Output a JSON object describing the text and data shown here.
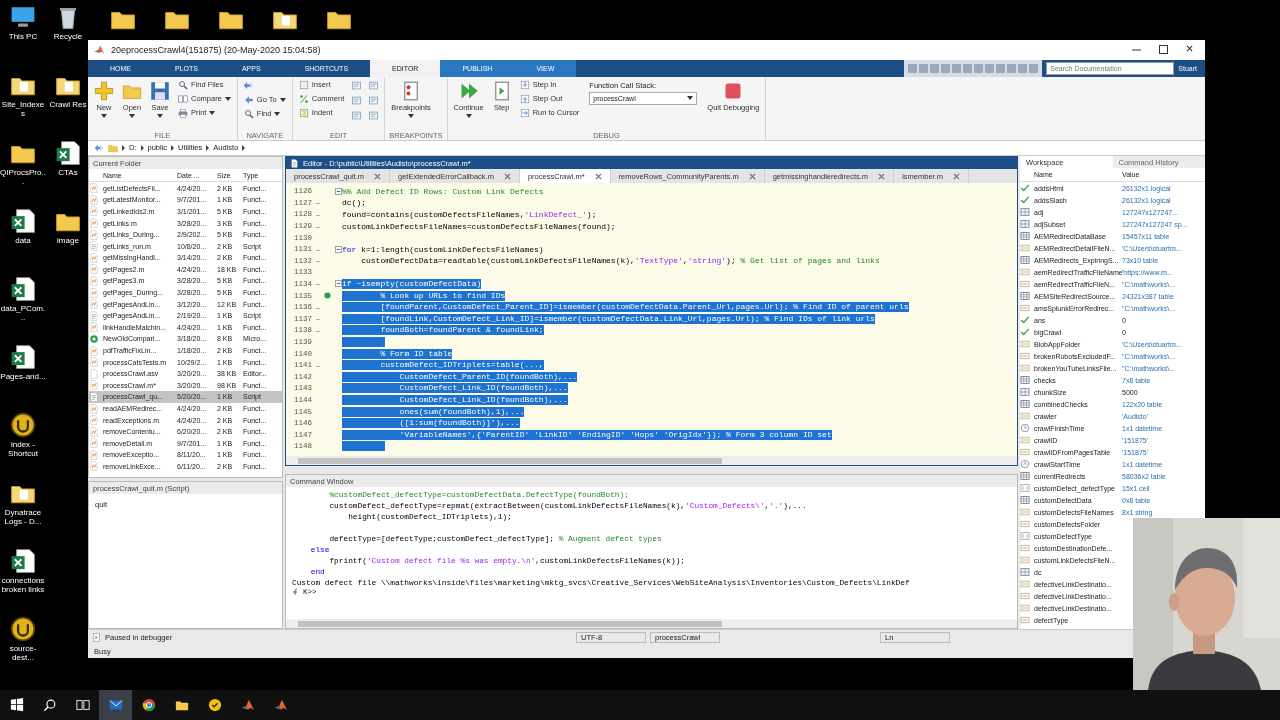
{
  "desktop": {
    "top_icons": [
      {
        "kind": "folder"
      },
      {
        "kind": "folder"
      },
      {
        "kind": "folder"
      },
      {
        "kind": "doc-folder"
      },
      {
        "kind": "folder"
      }
    ],
    "icons": [
      {
        "label": "This PC",
        "kind": "pc"
      },
      {
        "label": "Recycle",
        "kind": "bin"
      },
      {
        "label": "Site_Indexes",
        "kind": "doc-folder"
      },
      {
        "label": "Crawl Res",
        "kind": "doc-folder"
      },
      {
        "label": "QIProcsPro...",
        "kind": "folder"
      },
      {
        "label": "CTAs",
        "kind": "excel"
      },
      {
        "label": "data",
        "kind": "excel"
      },
      {
        "label": "image",
        "kind": "folder"
      },
      {
        "label": "data_PCom...",
        "kind": "excel"
      },
      {
        "label": "Pages-and...",
        "kind": "excel"
      },
      {
        "label": "index - Shortcut",
        "kind": "ue"
      },
      {
        "label": "Dynatrace Logs - D...",
        "kind": "doc-folder"
      },
      {
        "label": "connections broken links",
        "kind": "excel"
      },
      {
        "label": "source-dest...",
        "kind": "ue"
      }
    ]
  },
  "window": {
    "title": "20eprocessCrawl4(151875) (20-May-2020 15:04:58)",
    "tabs": [
      {
        "label": "HOME",
        "selected": false
      },
      {
        "label": "PLOTS",
        "selected": false
      },
      {
        "label": "APPS",
        "selected": false
      },
      {
        "label": "SHORTCUTS",
        "selected": false
      },
      {
        "label": "EDITOR",
        "selected": true
      },
      {
        "label": "PUBLISH",
        "selected": false
      },
      {
        "label": "VIEW",
        "selected": false
      }
    ],
    "search": {
      "placeholder": "Search Documentation"
    },
    "user": "Stuart",
    "toolstrip": [
      {
        "label": "FILE",
        "buttons": [
          {
            "kind": "large",
            "label": "New",
            "dropdown": true
          },
          {
            "kind": "large",
            "label": "Open",
            "dropdown": true
          },
          {
            "kind": "large",
            "label": "Save",
            "dropdown": true
          },
          {
            "kind": "small",
            "label": "Find Files",
            "dropdown": false
          },
          {
            "kind": "small",
            "label": "Compare",
            "dropdown": true
          },
          {
            "kind": "small",
            "label": "Print",
            "dropdown": true
          }
        ]
      },
      {
        "label": "NAVIGATE",
        "buttons": [
          {
            "kind": "icon"
          },
          {
            "kind": "small",
            "label": "Go To",
            "dropdown": true
          },
          {
            "kind": "small",
            "label": "Find",
            "dropdown": true
          }
        ]
      },
      {
        "label": "EDIT",
        "buttons": [
          {
            "kind": "small",
            "label": "Insert",
            "dropdown": false
          },
          {
            "kind": "small",
            "label": "Comment",
            "dropdown": false
          },
          {
            "kind": "small",
            "label": "Indent",
            "dropdown": false
          },
          {
            "kind": "icon"
          },
          {
            "kind": "icon"
          },
          {
            "kind": "icon"
          },
          {
            "kind": "icon"
          },
          {
            "kind": "icon"
          },
          {
            "kind": "icon"
          }
        ]
      },
      {
        "label": "BREAKPOINTS",
        "buttons": [
          {
            "kind": "large",
            "label": "Breakpoints",
            "dropdown": true
          }
        ]
      },
      {
        "label": "DEBUG",
        "buttons": [
          {
            "kind": "large",
            "label": "Continue",
            "dropdown": true
          },
          {
            "kind": "large",
            "label": "Step",
            "dropdown": false
          },
          {
            "kind": "small",
            "label": "Step In",
            "dropdown": false
          },
          {
            "kind": "small",
            "label": "Step Out",
            "dropdown": false
          },
          {
            "kind": "small",
            "label": "Run to Cursor",
            "dropdown": false
          },
          {
            "kind": "select",
            "label": "Function Call Stack:",
            "value": "processCrawl"
          },
          {
            "kind": "large",
            "label": "Quit Debugging",
            "dropdown": false
          }
        ]
      }
    ],
    "address": [
      "D:",
      "public",
      "Utilities",
      "Audisto"
    ]
  },
  "current_folder": {
    "title": "Current Folder",
    "columns": [
      "Name",
      "Date ...",
      "Size",
      "Type"
    ],
    "files": [
      {
        "name": "getListDefectsFil...",
        "date": "4/24/20...",
        "size": "2 KB",
        "type": "Funct...",
        "kind": "function",
        "selected": false
      },
      {
        "name": "getLatestMonitor...",
        "date": "9/7/201...",
        "size": "1 KB",
        "type": "Funct...",
        "kind": "function",
        "selected": false
      },
      {
        "name": "getLinkedIds2.m",
        "date": "3/1/201...",
        "size": "5 KB",
        "type": "Funct...",
        "kind": "function",
        "selected": false
      },
      {
        "name": "getLinks.m",
        "date": "3/28/20...",
        "size": "3 KB",
        "type": "Funct...",
        "kind": "function",
        "selected": false
      },
      {
        "name": "getLinks_During...",
        "date": "2/9/202...",
        "size": "5 KB",
        "type": "Funct...",
        "kind": "function",
        "selected": false
      },
      {
        "name": "getLinks_run.m",
        "date": "10/8/20...",
        "size": "2 KB",
        "type": "Script",
        "kind": "script",
        "selected": false
      },
      {
        "name": "getMissingHandl...",
        "date": "3/14/20...",
        "size": "2 KB",
        "type": "Funct...",
        "kind": "function",
        "selected": false
      },
      {
        "name": "getPages2.m",
        "date": "4/24/20...",
        "size": "18 KB",
        "type": "Funct...",
        "kind": "function",
        "selected": false
      },
      {
        "name": "getPages3.m",
        "date": "3/28/20...",
        "size": "5 KB",
        "type": "Funct...",
        "kind": "function",
        "selected": false
      },
      {
        "name": "getPages_During...",
        "date": "3/28/20...",
        "size": "5 KB",
        "type": "Funct...",
        "kind": "function",
        "selected": false
      },
      {
        "name": "getPagesAndLin...",
        "date": "3/12/20...",
        "size": "12 KB",
        "type": "Funct...",
        "kind": "function",
        "selected": false
      },
      {
        "name": "getPagesAndLin...",
        "date": "2/19/20...",
        "size": "1 KB",
        "type": "Script",
        "kind": "script",
        "selected": false
      },
      {
        "name": "linkHandleMatchin...",
        "date": "4/24/20...",
        "size": "1 KB",
        "type": "Funct...",
        "kind": "function",
        "selected": false
      },
      {
        "name": "NewOldCompari...",
        "date": "3/18/20...",
        "size": "8 KB",
        "type": "Micro...",
        "kind": "live",
        "selected": false
      },
      {
        "name": "pdfTrafficFixLin...",
        "date": "1/18/20...",
        "size": "2 KB",
        "type": "Funct...",
        "kind": "function",
        "selected": false
      },
      {
        "name": "processCatsTests.m",
        "date": "10/29/2...",
        "size": "1 KB",
        "type": "Funct...",
        "kind": "function",
        "selected": false
      },
      {
        "name": "processCrawl.asv",
        "date": "3/20/20...",
        "size": "38 KB",
        "type": "Editor...",
        "kind": "file",
        "selected": false
      },
      {
        "name": "processCrawl.m*",
        "date": "3/20/20...",
        "size": "98 KB",
        "type": "Funct...",
        "kind": "function",
        "selected": false
      },
      {
        "name": "processCrawl_qu...",
        "date": "5/20/20...",
        "size": "1 KB",
        "type": "Script",
        "kind": "script",
        "selected": true
      },
      {
        "name": "readAEMRedirec...",
        "date": "4/24/20...",
        "size": "2 KB",
        "type": "Funct...",
        "kind": "function",
        "selected": false
      },
      {
        "name": "readExceptions.m",
        "date": "4/24/20...",
        "size": "2 KB",
        "type": "Funct...",
        "kind": "function",
        "selected": false
      },
      {
        "name": "removeContentu...",
        "date": "6/20/20...",
        "size": "2 KB",
        "type": "Funct...",
        "kind": "function",
        "selected": false
      },
      {
        "name": "removeDetail.m",
        "date": "9/7/201...",
        "size": "1 KB",
        "type": "Funct...",
        "kind": "function",
        "selected": false
      },
      {
        "name": "removeExceptio...",
        "date": "8/11/20...",
        "size": "1 KB",
        "type": "Funct...",
        "kind": "function",
        "selected": false
      },
      {
        "name": "removeLinkExce...",
        "date": "6/11/20...",
        "size": "2 KB",
        "type": "Funct...",
        "kind": "function",
        "selected": false
      }
    ]
  },
  "details": {
    "title": "processCrawl_quit.m (Script)",
    "content": "quit"
  },
  "editor": {
    "title": "Editor - D:\\public\\Utilities\\Audisto\\processCrawl.m*",
    "tabs": [
      {
        "label": "processCrawl_quit.m",
        "selected": false
      },
      {
        "label": "getExtendedErrorCallback.m",
        "selected": false
      },
      {
        "label": "processCrawl.m*",
        "selected": true
      },
      {
        "label": "removeRows_CommunityParents.m",
        "selected": false
      },
      {
        "label": "getmissinghandleredirects.m",
        "selected": false
      },
      {
        "label": "ismember.m",
        "selected": false
      }
    ],
    "lines": [
      {
        "number": "1126",
        "fold": true,
        "current": false,
        "selected": false,
        "segments": [
          {
            "kind": "comment",
            "text": "%% Add Defect ID Rows: Custom Link Defects"
          }
        ]
      },
      {
        "number": "1127",
        "marker": "–",
        "fold": false,
        "current": false,
        "selected": false,
        "segments": [
          {
            "kind": "code",
            "text": "dc();"
          }
        ]
      },
      {
        "number": "1128",
        "marker": "–",
        "fold": false,
        "current": false,
        "selected": false,
        "segments": [
          {
            "kind": "code",
            "text": "found=contains(customDefectsFileNames,"
          },
          {
            "kind": "string",
            "text": "'LinkDefect_'"
          },
          {
            "kind": "code",
            "text": ");"
          }
        ]
      },
      {
        "number": "1129",
        "marker": "–",
        "fold": false,
        "current": false,
        "selected": false,
        "segments": [
          {
            "kind": "code",
            "text": "customLinkDefectsFileNames=customDefectsFileNames(found);"
          }
        ]
      },
      {
        "number": "1130",
        "fold": false,
        "current": false,
        "selected": false
      },
      {
        "number": "1131",
        "marker": "–",
        "fold": true,
        "current": false,
        "selected": false,
        "segments": [
          {
            "kind": "keyword",
            "text": "for"
          },
          {
            "kind": "code",
            "text": " k=1:length(customLinkDefectsFileNames)"
          }
        ]
      },
      {
        "number": "1132",
        "marker": "–",
        "fold": false,
        "current": false,
        "selected": false,
        "segments": [
          {
            "kind": "code",
            "text": "    customDefectData=readtable(customLinkDefectsFileNames(k),"
          },
          {
            "kind": "string",
            "text": "'TextType'"
          },
          {
            "kind": "code",
            "text": ","
          },
          {
            "kind": "string",
            "text": "'string'"
          },
          {
            "kind": "code",
            "text": "); "
          },
          {
            "kind": "comment",
            "text": "% Get list of pages and links"
          }
        ]
      },
      {
        "number": "1133",
        "fold": false,
        "current": false,
        "selected": false
      },
      {
        "number": "1134",
        "marker": "–",
        "fold": true,
        "current": false,
        "selected": true,
        "segments": [
          {
            "kind": "keyword",
            "text": "if"
          },
          {
            "kind": "code",
            "text": " ~isempty(customDefectData)"
          }
        ]
      },
      {
        "number": "1135",
        "fold": false,
        "current": true,
        "selected": true,
        "segments": [
          {
            "kind": "comment",
            "text": "        % Look up URLs to find IDs"
          }
        ]
      },
      {
        "number": "1136",
        "marker": "–",
        "fold": false,
        "current": false,
        "selected": true,
        "segments": [
          {
            "kind": "code",
            "text": "        [foundParent,CustomDefect_Parent_ID]=ismember(customDefectData.Parent_Url,pages.Url); "
          },
          {
            "kind": "comment",
            "text": "% Find ID of parent urls"
          }
        ]
      },
      {
        "number": "1137",
        "marker": "–",
        "fold": false,
        "current": false,
        "selected": true,
        "segments": [
          {
            "kind": "code",
            "text": "        [foundLink,CustomDefect_Link_ID]=ismember(customDefectData.Link_Url,pages.Url); "
          },
          {
            "kind": "comment",
            "text": "% Find IDs of link urls"
          }
        ]
      },
      {
        "number": "1138",
        "marker": "–",
        "fold": false,
        "current": false,
        "selected": true,
        "segments": [
          {
            "kind": "code",
            "text": "        foundBoth=foundParent & foundLink;"
          }
        ]
      },
      {
        "number": "1139",
        "fold": false,
        "current": false,
        "selected": true
      },
      {
        "number": "1140",
        "fold": false,
        "current": false,
        "selected": true,
        "segments": [
          {
            "kind": "comment",
            "text": "        % Form ID table"
          }
        ]
      },
      {
        "number": "1141",
        "marker": "–",
        "fold": false,
        "current": false,
        "selected": true,
        "segments": [
          {
            "kind": "code",
            "text": "        customDefect_IDTriplets=table(...,"
          }
        ]
      },
      {
        "number": "1142",
        "fold": false,
        "current": false,
        "selected": true,
        "segments": [
          {
            "kind": "code",
            "text": "            CustomDefect_Parent_ID(foundBoth),..."
          }
        ]
      },
      {
        "number": "1143",
        "fold": false,
        "current": false,
        "selected": true,
        "segments": [
          {
            "kind": "code",
            "text": "            CustomDefect_Link_ID(foundBoth),..."
          }
        ]
      },
      {
        "number": "1144",
        "fold": false,
        "current": false,
        "selected": true,
        "segments": [
          {
            "kind": "code",
            "text": "            CustomDefect_Link_ID(foundBoth),..."
          }
        ]
      },
      {
        "number": "1145",
        "fold": false,
        "current": false,
        "selected": true,
        "segments": [
          {
            "kind": "code",
            "text": "            ones(sum(foundBoth),1),..."
          }
        ]
      },
      {
        "number": "1146",
        "fold": false,
        "current": false,
        "selected": true,
        "segments": [
          {
            "kind": "code",
            "text": "            ([1:sum(foundBoth)]'),..."
          }
        ]
      },
      {
        "number": "1147",
        "fold": false,
        "current": false,
        "selected": true,
        "segments": [
          {
            "kind": "code",
            "text": "            'VariableNames',{'ParentID' 'LinkID' 'EndingID' 'Hops' 'OrigIdx'}); % Form 3 column ID set"
          }
        ]
      },
      {
        "number": "1148",
        "fold": false,
        "current": false,
        "selected": true
      }
    ]
  },
  "command_window": {
    "title": "Command Window",
    "lines": [
      {
        "segments": [
          {
            "kind": "comment",
            "text": "        %customDefect_defectType=customDefectData.DefectType(foundBoth);"
          }
        ]
      },
      {
        "segments": [
          {
            "kind": "code",
            "text": "        customDefect_defectType=repmat(extractBetween(customLinkDefectsFileNames(k),"
          },
          {
            "kind": "string",
            "text": "'Custom_Defects\\'"
          },
          {
            "kind": "code",
            "text": ","
          },
          {
            "kind": "string",
            "text": "'.'"
          },
          {
            "kind": "code",
            "text": "),..."
          }
        ]
      },
      {
        "segments": [
          {
            "kind": "code",
            "text": "            height(customDefect_IDTriplets),1);"
          }
        ]
      },
      {
        "kind": "blank"
      },
      {
        "segments": [
          {
            "kind": "code",
            "text": "        defectType=[defectType;customDefect_defectType]; "
          },
          {
            "kind": "comment",
            "text": "% Augment defect types"
          }
        ]
      },
      {
        "segments": [
          {
            "kind": "keyword",
            "text": "    else"
          }
        ]
      },
      {
        "segments": [
          {
            "kind": "code",
            "text": "        fprintf("
          },
          {
            "kind": "string",
            "text": "'Custom defect file %s was empty.\\n'"
          },
          {
            "kind": "code",
            "text": ",customLinkDefectsFileNames(k));"
          }
        ]
      },
      {
        "segments": [
          {
            "kind": "keyword",
            "text": "    end"
          }
        ]
      },
      {
        "segments": [
          {
            "kind": "code",
            "text": "Custom defect file \\\\mathworks\\inside\\files\\marketing\\mktg_svcs\\Creative_Services\\WebSiteAnalysis\\Inventories\\Custom_Defects\\LinkDef"
          }
        ]
      }
    ],
    "prompt": "K>>"
  },
  "workspace": {
    "tabs": [
      {
        "label": "Workspace",
        "selected": true
      },
      {
        "label": "Command History",
        "selected": false
      }
    ],
    "columns": [
      "Name",
      "Value"
    ],
    "variables": [
      {
        "name": "addsHtml",
        "value": "26132x1 logical",
        "kind": "logical"
      },
      {
        "name": "addsSlash",
        "value": "26132x1 logical",
        "kind": "logical"
      },
      {
        "name": "adj",
        "value": "127247x127247...",
        "kind": "matrix"
      },
      {
        "name": "adjSubset",
        "value": "127247x127247 sp...",
        "kind": "matrix"
      },
      {
        "name": "AEMRedirectDataBase",
        "value": "15457x11 table",
        "kind": "table"
      },
      {
        "name": "AEMRedirectDetailFileN...",
        "value": "'C:\\Users\\stuartm...",
        "kind": "char"
      },
      {
        "name": "AEMRedirects_ExpiringS...",
        "value": "73x10 table",
        "kind": "table"
      },
      {
        "name": "aemRedirectTrafficFileName",
        "value": "'https://www.m...",
        "kind": "char"
      },
      {
        "name": "aemRedirectTrafficFileN...",
        "value": "\"C:\\mathworks\\...",
        "kind": "char"
      },
      {
        "name": "AEMSiteRedirectSource...",
        "value": "24321x387 table",
        "kind": "table"
      },
      {
        "name": "amsSplunkErrorRedirec...",
        "value": "\"C:\\mathworks\\...",
        "kind": "char"
      },
      {
        "name": "ans",
        "value": "0",
        "kind": "logical"
      },
      {
        "name": "bigCrawl",
        "value": "0",
        "kind": "logical"
      },
      {
        "name": "BlobAppFolder",
        "value": "'C:\\Users\\stuartm...",
        "kind": "char"
      },
      {
        "name": "brokenRobotsExcludedF...",
        "value": "\"C:\\mathworks\\...",
        "kind": "char"
      },
      {
        "name": "brokenYouTubeLinksFile...",
        "value": "\"C:\\mathworks\\...",
        "kind": "char"
      },
      {
        "name": "checks",
        "value": "7x8 table",
        "kind": "table"
      },
      {
        "name": "chunkSize",
        "value": "5000",
        "kind": "number"
      },
      {
        "name": "combinedChecks",
        "value": "122x20 table",
        "kind": "table"
      },
      {
        "name": "crawler",
        "value": "'Audisto'",
        "kind": "char"
      },
      {
        "name": "crawlFinishTime",
        "value": "1x1 datetime",
        "kind": "datetime"
      },
      {
        "name": "crawlID",
        "value": "'151875'",
        "kind": "char"
      },
      {
        "name": "crawlIDFromPagesTable",
        "value": "'151875'",
        "kind": "char"
      },
      {
        "name": "crawlStartTime",
        "value": "1x1 datetime",
        "kind": "datetime"
      },
      {
        "name": "currentRedirects",
        "value": "58036x2 table",
        "kind": "table"
      },
      {
        "name": "customDefect_defectType",
        "value": "15x1 cell",
        "kind": "cell"
      },
      {
        "name": "customDefectData",
        "value": "0x8 table",
        "kind": "table"
      },
      {
        "name": "customDefectsFileNames",
        "value": "8x1 string",
        "kind": "string"
      },
      {
        "name": "customDefectsFolder",
        "kind": "char"
      },
      {
        "name": "customDefectType",
        "kind": "cell"
      },
      {
        "name": "customDestinationDefe...",
        "kind": "char"
      },
      {
        "name": "customLinkDefectsFileN...",
        "kind": "string"
      },
      {
        "name": "dc",
        "kind": "matrix"
      },
      {
        "name": "defectiveLinkDestinatio...",
        "kind": "char"
      },
      {
        "name": "defectiveLinkDestinatio...",
        "kind": "char"
      },
      {
        "name": "defectiveLinkDestinatio...",
        "kind": "char"
      },
      {
        "name": "defectType",
        "kind": "string"
      }
    ]
  },
  "status_bar": {
    "message": "Paused in debugger",
    "fields": [
      "UTF-8",
      "processCrawl",
      "Ln"
    ],
    "busy": "Busy"
  },
  "taskbar": [
    {
      "kind": "start",
      "selected": false
    },
    {
      "kind": "search",
      "selected": false
    },
    {
      "kind": "taskview",
      "selected": false
    },
    {
      "kind": "mail",
      "selected": true
    },
    {
      "kind": "browser",
      "selected": false
    },
    {
      "kind": "explorer",
      "selected": false
    },
    {
      "kind": "shield",
      "selected": false
    },
    {
      "kind": "matlab",
      "selected": false
    },
    {
      "kind": "matlab",
      "selected": false
    }
  ]
}
